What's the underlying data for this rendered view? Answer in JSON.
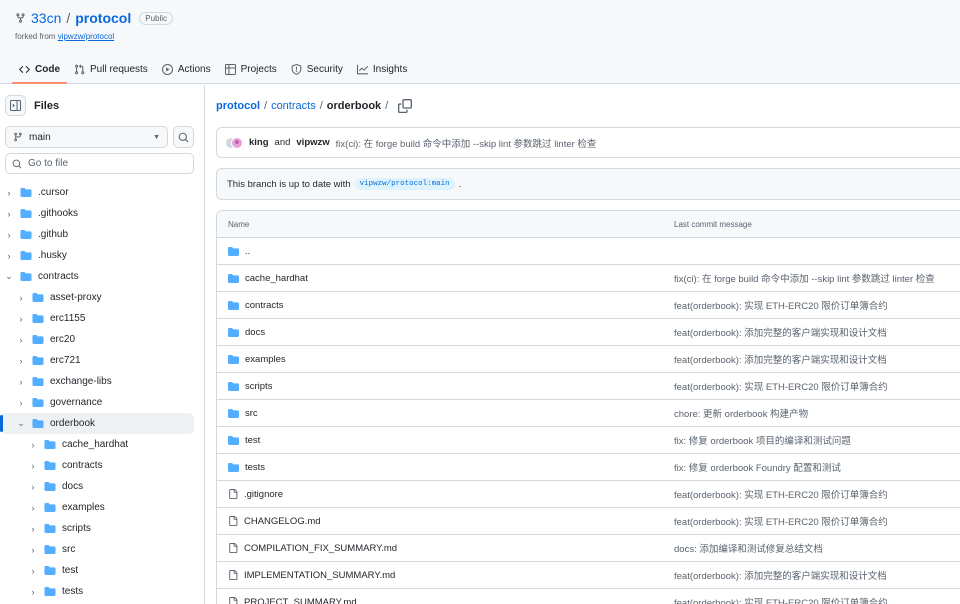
{
  "header": {
    "owner": "33cn",
    "repo": "protocol",
    "visibility": "Public",
    "forked_prefix": "forked from",
    "forked_from": "vipwzw/protocol",
    "tabs": [
      {
        "label": "Code",
        "icon": "code-icon",
        "active": true
      },
      {
        "label": "Pull requests",
        "icon": "pull-request-icon",
        "active": false
      },
      {
        "label": "Actions",
        "icon": "play-icon",
        "active": false
      },
      {
        "label": "Projects",
        "icon": "table-icon",
        "active": false
      },
      {
        "label": "Security",
        "icon": "shield-icon",
        "active": false
      },
      {
        "label": "Insights",
        "icon": "graph-icon",
        "active": false
      }
    ]
  },
  "sidebar": {
    "title": "Files",
    "branch": "main",
    "goto_placeholder": "Go to file",
    "tree": [
      {
        "label": ".cursor",
        "level": 0,
        "expanded": false
      },
      {
        "label": ".githooks",
        "level": 0,
        "expanded": false
      },
      {
        "label": ".github",
        "level": 0,
        "expanded": false
      },
      {
        "label": ".husky",
        "level": 0,
        "expanded": false
      },
      {
        "label": "contracts",
        "level": 0,
        "expanded": true
      },
      {
        "label": "asset-proxy",
        "level": 1,
        "expanded": false
      },
      {
        "label": "erc1155",
        "level": 1,
        "expanded": false
      },
      {
        "label": "erc20",
        "level": 1,
        "expanded": false
      },
      {
        "label": "erc721",
        "level": 1,
        "expanded": false
      },
      {
        "label": "exchange-libs",
        "level": 1,
        "expanded": false
      },
      {
        "label": "governance",
        "level": 1,
        "expanded": false
      },
      {
        "label": "orderbook",
        "level": 1,
        "expanded": true,
        "selected": true
      },
      {
        "label": "cache_hardhat",
        "level": 2,
        "expanded": false
      },
      {
        "label": "contracts",
        "level": 2,
        "expanded": false
      },
      {
        "label": "docs",
        "level": 2,
        "expanded": false
      },
      {
        "label": "examples",
        "level": 2,
        "expanded": false
      },
      {
        "label": "scripts",
        "level": 2,
        "expanded": false
      },
      {
        "label": "src",
        "level": 2,
        "expanded": false
      },
      {
        "label": "test",
        "level": 2,
        "expanded": false
      },
      {
        "label": "tests",
        "level": 2,
        "expanded": false
      }
    ]
  },
  "main": {
    "breadcrumb": {
      "root": "protocol",
      "sep": "/",
      "mid": "contracts",
      "current": "orderbook",
      "trail": "/"
    },
    "commit": {
      "author1": "king",
      "and": "and",
      "author2": "vipwzw",
      "message": "fix(ci): 在 forge build 命令中添加 --skip lint 参数跳过 linter 检查"
    },
    "status": {
      "text": "This branch is up to date with",
      "ref": "vipwzw/protocol:main",
      "suffix": "."
    },
    "table": {
      "col_name": "Name",
      "col_commit": "Last commit message",
      "rows": [
        {
          "name": "..",
          "type": "dir",
          "commit": ""
        },
        {
          "name": "cache_hardhat",
          "type": "dir",
          "commit": "fix(ci): 在 forge build 命令中添加 --skip lint 参数跳过 linter 检查"
        },
        {
          "name": "contracts",
          "type": "dir",
          "commit": "feat(orderbook): 实现 ETH-ERC20 限价订单簿合约"
        },
        {
          "name": "docs",
          "type": "dir",
          "commit": "feat(orderbook): 添加完整的客户端实现和设计文档"
        },
        {
          "name": "examples",
          "type": "dir",
          "commit": "feat(orderbook): 添加完整的客户端实现和设计文档"
        },
        {
          "name": "scripts",
          "type": "dir",
          "commit": "feat(orderbook): 实现 ETH-ERC20 限价订单簿合约"
        },
        {
          "name": "src",
          "type": "dir",
          "commit": "chore: 更新 orderbook 构建产物"
        },
        {
          "name": "test",
          "type": "dir",
          "commit": "fix: 修复 orderbook 项目的编译和测试问题"
        },
        {
          "name": "tests",
          "type": "dir",
          "commit": "fix: 修复 orderbook Foundry 配置和测试"
        },
        {
          "name": ".gitignore",
          "type": "file",
          "commit": "feat(orderbook): 实现 ETH-ERC20 限价订单簿合约"
        },
        {
          "name": "CHANGELOG.md",
          "type": "file",
          "commit": "feat(orderbook): 实现 ETH-ERC20 限价订单簿合约"
        },
        {
          "name": "COMPILATION_FIX_SUMMARY.md",
          "type": "file",
          "commit": "docs: 添加编译和测试修复总结文档"
        },
        {
          "name": "IMPLEMENTATION_SUMMARY.md",
          "type": "file",
          "commit": "feat(orderbook): 添加完整的客户端实现和设计文档"
        },
        {
          "name": "PROJECT_SUMMARY.md",
          "type": "file",
          "commit": "feat(orderbook): 实现 ETH-ERC20 限价订单簿合约"
        }
      ]
    }
  },
  "colors": {
    "link": "#0969da",
    "folder": "#54aeff",
    "border": "#d1d9e0",
    "muted": "#59636e",
    "tab_underline": "#fd8c73"
  }
}
